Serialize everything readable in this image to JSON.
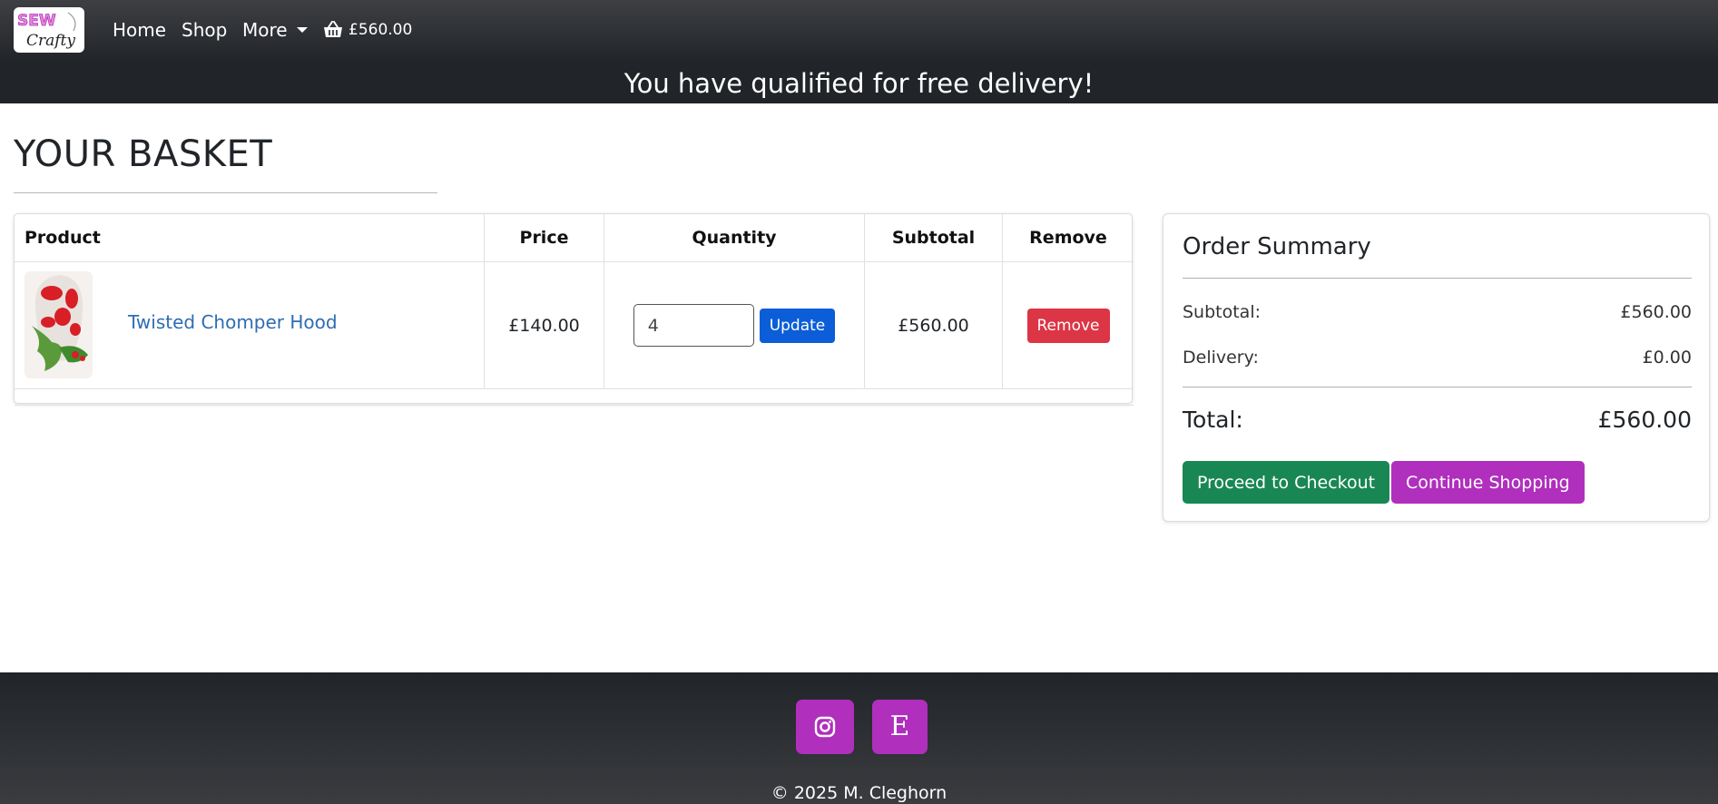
{
  "header": {
    "logo": {
      "line1": "SEW",
      "line2": "Crafty"
    },
    "nav": {
      "home": "Home",
      "shop": "Shop",
      "more": "More"
    },
    "cart_total": "£560.00",
    "promo": "You have qualified for free delivery!"
  },
  "main": {
    "title": "YOUR BASKET",
    "columns": [
      "Product",
      "Price",
      "Quantity",
      "Subtotal",
      "Remove"
    ],
    "items": [
      {
        "name": "Twisted Chomper Hood",
        "price": "£140.00",
        "quantity": "4",
        "update_label": "Update",
        "subtotal": "£560.00",
        "remove_label": "Remove"
      }
    ]
  },
  "summary": {
    "title": "Order Summary",
    "subtotal_label": "Subtotal:",
    "subtotal_value": "£560.00",
    "delivery_label": "Delivery:",
    "delivery_value": "£0.00",
    "total_label": "Total:",
    "total_value": "£560.00",
    "checkout_label": "Proceed to Checkout",
    "continue_label": "Continue Shopping"
  },
  "footer": {
    "icons": [
      "instagram-icon",
      "etsy-icon"
    ],
    "etsy_glyph": "E",
    "copyright": "© 2025 M. Cleghorn"
  },
  "colors": {
    "header_bg": "#212428",
    "update_button": "#0b5ed7",
    "remove_button": "#dc3545",
    "checkout_button": "#198754",
    "continue_button": "#b02fbd",
    "social_button": "#b02fbd",
    "product_link": "#2d6db3"
  }
}
